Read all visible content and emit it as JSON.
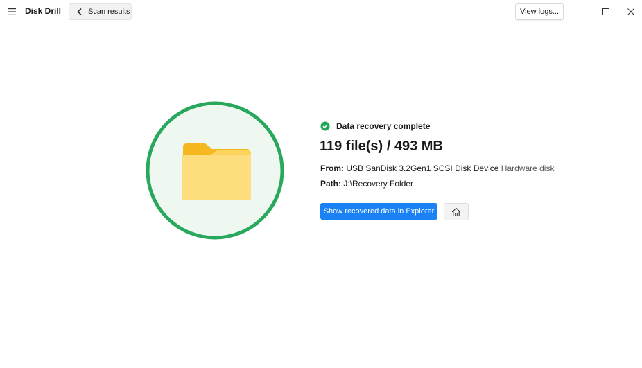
{
  "app": {
    "title": "Disk Drill"
  },
  "toolbar": {
    "back_label": "Scan results",
    "view_logs_label": "View logs..."
  },
  "result": {
    "status": "Data recovery complete",
    "summary": "119 file(s) / 493 MB",
    "from_label": "From:",
    "from_value": "USB  SanDisk 3.2Gen1 SCSI Disk Device",
    "from_type": "Hardware disk",
    "path_label": "Path:",
    "path_value": "J:\\Recovery Folder",
    "show_button_label": "Show recovered data in Explorer"
  },
  "icons": {
    "menu": "hamburger-menu-icon",
    "back": "chevron-left-icon",
    "minimize": "minimize-icon",
    "maximize": "maximize-icon",
    "close": "close-icon",
    "status": "check-circle-icon",
    "home": "home-icon",
    "illustration": "folder-icon"
  },
  "colors": {
    "accent": "#1a82f5",
    "success": "#21a65a",
    "ring": "#27a85c",
    "ring_fill": "#eff7f1",
    "folder_back": "#f5b820",
    "folder_front": "#fddd7e"
  }
}
